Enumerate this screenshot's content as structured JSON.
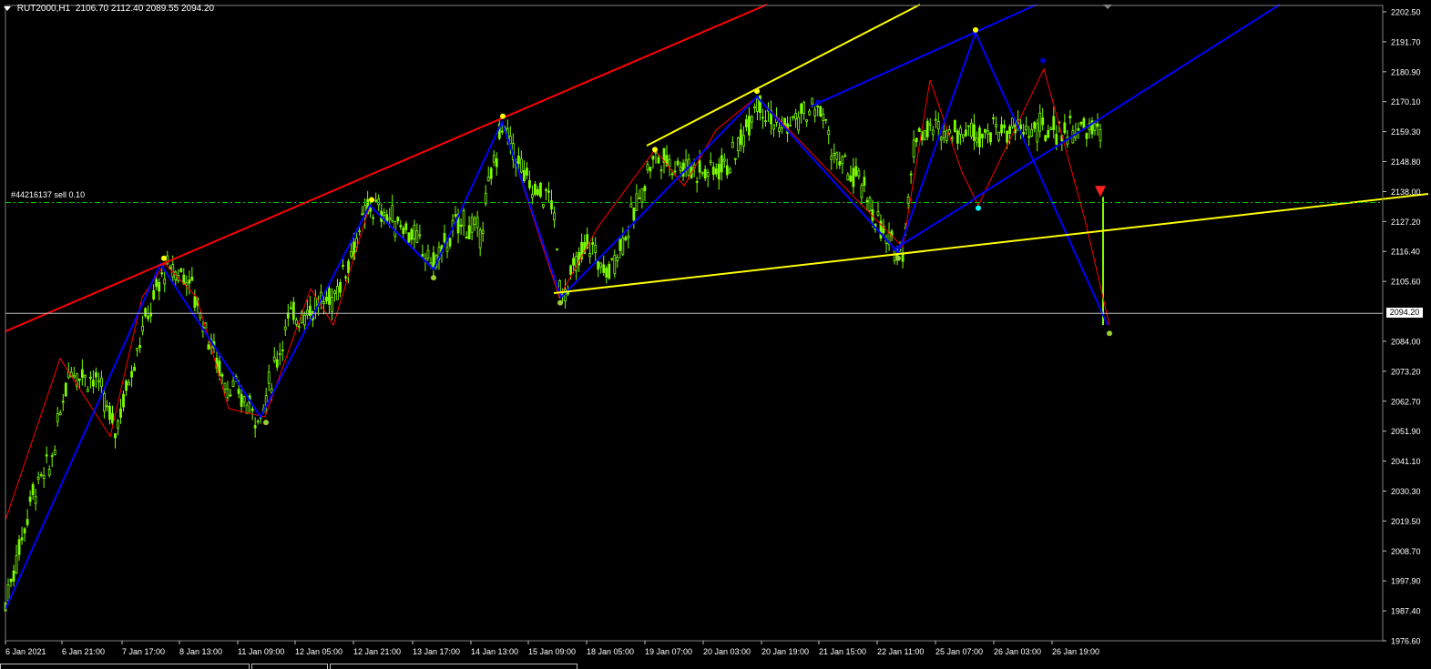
{
  "header": {
    "symbol": "RUT2000,H1",
    "ohlc": "2106.70 2112.40 2089.55 2094.20"
  },
  "order_line": {
    "label": "#44216137 sell 0.10",
    "price": 2134.0
  },
  "current_price": {
    "label": "2094.20",
    "value": 2094.2
  },
  "colors": {
    "background": "#000000",
    "bull_candle": "#7CFC00",
    "zigzag_major": "#0000FF",
    "zigzag_minor": "#FF0000",
    "channel_red": "#FF0000",
    "channel_yellow": "#FFFF00",
    "price_line": "#C0C0C0",
    "order_line": "#00C000",
    "axis_text": "#FFFFFF"
  },
  "chart_data": {
    "type": "candlestick",
    "ylim": [
      1976.6,
      2202.5
    ],
    "y_ticks": [
      "2202.50",
      "2191.70",
      "2180.90",
      "2170.10",
      "2159.30",
      "2148.80",
      "2138.00",
      "2127.20",
      "2116.40",
      "2105.60",
      "2094.20",
      "2084.00",
      "2073.20",
      "2062.70",
      "2051.90",
      "2041.10",
      "2030.30",
      "2019.50",
      "2008.70",
      "1997.90",
      "1987.40",
      "1976.60"
    ],
    "x_ticks": [
      "6 Jan 2021",
      "6 Jan 21:00",
      "7 Jan 17:00",
      "8 Jan 13:00",
      "11 Jan 09:00",
      "12 Jan 05:00",
      "12 Jan 21:00",
      "13 Jan 17:00",
      "14 Jan 13:00",
      "15 Jan 09:00",
      "18 Jan 05:00",
      "19 Jan 07:00",
      "20 Jan 03:00",
      "20 Jan 19:00",
      "21 Jan 15:00",
      "22 Jan 11:00",
      "25 Jan 07:00",
      "26 Jan 03:00",
      "26 Jan 19:00"
    ],
    "price_path": [
      {
        "t": 0,
        "p": 1990
      },
      {
        "t": 0.03,
        "p": 2030
      },
      {
        "t": 0.05,
        "p": 2040
      },
      {
        "t": 0.07,
        "p": 2075
      },
      {
        "t": 0.1,
        "p": 2070
      },
      {
        "t": 0.12,
        "p": 2052
      },
      {
        "t": 0.15,
        "p": 2088
      },
      {
        "t": 0.175,
        "p": 2110
      },
      {
        "t": 0.2,
        "p": 2108
      },
      {
        "t": 0.24,
        "p": 2070
      },
      {
        "t": 0.28,
        "p": 2057
      },
      {
        "t": 0.31,
        "p": 2092
      },
      {
        "t": 0.36,
        "p": 2100
      },
      {
        "t": 0.4,
        "p": 2133
      },
      {
        "t": 0.44,
        "p": 2125
      },
      {
        "t": 0.47,
        "p": 2112
      },
      {
        "t": 0.5,
        "p": 2128
      },
      {
        "t": 0.52,
        "p": 2122
      },
      {
        "t": 0.545,
        "p": 2162
      },
      {
        "t": 0.575,
        "p": 2140
      },
      {
        "t": 0.6,
        "p": 2135
      },
      {
        "t": 0.61,
        "p": 2100
      },
      {
        "t": 0.64,
        "p": 2120
      },
      {
        "t": 0.66,
        "p": 2108
      },
      {
        "t": 0.69,
        "p": 2130
      },
      {
        "t": 0.71,
        "p": 2150
      },
      {
        "t": 0.74,
        "p": 2148
      },
      {
        "t": 0.77,
        "p": 2145
      },
      {
        "t": 0.8,
        "p": 2150
      },
      {
        "t": 0.825,
        "p": 2172
      },
      {
        "t": 0.85,
        "p": 2160
      },
      {
        "t": 0.875,
        "p": 2165
      },
      {
        "t": 0.895,
        "p": 2168
      },
      {
        "t": 0.91,
        "p": 2150
      },
      {
        "t": 0.94,
        "p": 2140
      },
      {
        "t": 0.97,
        "p": 2118
      },
      {
        "t": 0.985,
        "p": 2118
      },
      {
        "t": 1.0,
        "p": 2160
      }
    ],
    "zigzag_major": [
      {
        "x": 0.0,
        "y": 1988
      },
      {
        "x": 0.17,
        "y": 2112
      },
      {
        "x": 0.28,
        "y": 2057
      },
      {
        "x": 0.4,
        "y": 2133
      },
      {
        "x": 0.47,
        "y": 2110
      },
      {
        "x": 0.545,
        "y": 2163
      },
      {
        "x": 0.61,
        "y": 2100
      },
      {
        "x": 0.825,
        "y": 2172
      },
      {
        "x": 0.98,
        "y": 2116
      },
      {
        "x": 1.065,
        "y": 2195
      },
      {
        "x": 1.21,
        "y": 2090
      }
    ],
    "markers": [
      {
        "x": 0.174,
        "y": 2114,
        "color": "#FFFF00"
      },
      {
        "x": 0.286,
        "y": 2055,
        "color": "#9ACD32"
      },
      {
        "x": 0.402,
        "y": 2135,
        "color": "#FFFF00"
      },
      {
        "x": 0.47,
        "y": 2107,
        "color": "#9ACD32"
      },
      {
        "x": 0.546,
        "y": 2165,
        "color": "#FFFF00"
      },
      {
        "x": 0.609,
        "y": 2098,
        "color": "#9ACD32"
      },
      {
        "x": 0.713,
        "y": 2153,
        "color": "#FFFF00"
      },
      {
        "x": 0.825,
        "y": 2174,
        "color": "#FFFF00"
      },
      {
        "x": 0.892,
        "y": 2170,
        "color": "#0000CD"
      },
      {
        "x": 0.98,
        "y": 2114,
        "color": "#9ACD32"
      },
      {
        "x": 1.065,
        "y": 2196,
        "color": "#FFFF00"
      },
      {
        "x": 1.068,
        "y": 2132,
        "color": "#00FFFF"
      },
      {
        "x": 1.139,
        "y": 2185,
        "color": "#0000CD"
      },
      {
        "x": 1.212,
        "y": 2087,
        "color": "#9ACD32"
      }
    ],
    "grid": false,
    "legend": "none"
  },
  "tabs": [
    "",
    "",
    ""
  ]
}
